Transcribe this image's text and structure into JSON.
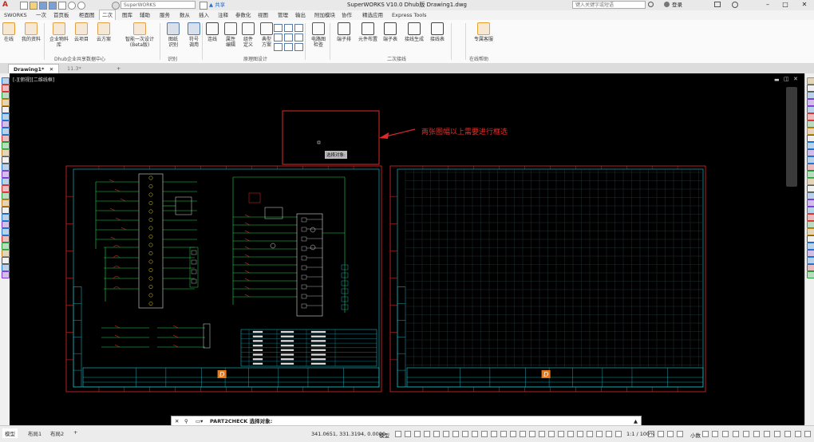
{
  "titlebar": {
    "app_select": "SuperWORKS",
    "share_label": "共享",
    "title": "SuperWORKS V10.0 Dhub版    Drawing1.dwg",
    "search_placeholder": "键入关键字或短语",
    "login_label": "登录"
  },
  "menu": {
    "tabs": [
      "SWORKS",
      "一次",
      "首页板",
      "柜面图",
      "二次",
      "图库",
      "辅助",
      "服务",
      "数从",
      "插入",
      "注释",
      "参数化",
      "视图",
      "管理",
      "输出",
      "附加模块",
      "协作",
      "精选应用",
      "Express Tools"
    ],
    "active_index": 4
  },
  "ribbon": {
    "buttons": [
      {
        "label": "在线",
        "color": "#e89a2c"
      },
      {
        "label": "我的资料",
        "color": "#e2a048"
      },
      {
        "label": "企业物料库",
        "color": "#e2a048"
      },
      {
        "label": "云项目",
        "color": "#e2a048"
      },
      {
        "label": "云方案",
        "color": "#e2a048"
      },
      {
        "label": "智能一次设计\n(Beta版)",
        "color": "#e2a048"
      },
      {
        "label": "图纸\n识别",
        "color": "#5a7aa8"
      },
      {
        "label": "符号\n调用",
        "color": "#4a7ab0"
      },
      {
        "label": "连线",
        "color": "#444"
      },
      {
        "label": "属性\n编辑",
        "color": "#555"
      },
      {
        "label": "组件\n定义",
        "color": "#555"
      },
      {
        "label": "典型\n方案",
        "color": "#555"
      },
      {
        "label": "电路图\n检查",
        "color": "#555"
      },
      {
        "label": "端子排",
        "color": "#444"
      },
      {
        "label": "元件布置",
        "color": "#444"
      },
      {
        "label": "端子表",
        "color": "#444"
      },
      {
        "label": "接线生成",
        "color": "#444"
      },
      {
        "label": "接线表",
        "color": "#444"
      },
      {
        "label": "专属客服",
        "color": "#e8a030"
      }
    ],
    "groups": [
      "Dhub企业共享数据中心",
      "识别",
      "原理图设计",
      "二次接线",
      "在线帮助"
    ]
  },
  "doctabs": [
    "Drawing1*",
    "11.3*"
  ],
  "viewport_label": "[-][俯视][二维线框]",
  "annotation": {
    "text": "两张图幅以上需要进行框选",
    "color": "#e0302a",
    "tooltip": "选择对象:"
  },
  "titleblock": {
    "logo_text": "D"
  },
  "command": {
    "prompt": "PART2CHECK 选择对象:"
  },
  "status": {
    "layout_tabs": [
      "模型",
      "布局1",
      "布局2"
    ],
    "coords": "341.0651, 331.3194, 0.0000",
    "model_label": "模型",
    "scale": "1:1 / 100%",
    "units": "小数"
  }
}
